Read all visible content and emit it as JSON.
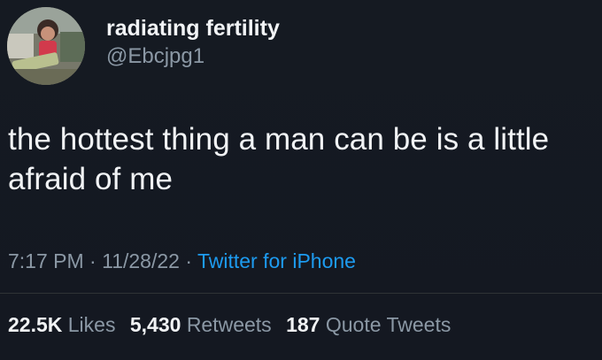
{
  "user": {
    "display_name": "radiating fertility",
    "handle": "@Ebcjpg1"
  },
  "tweet": {
    "text": "the hottest thing a man can be is a little afraid of me",
    "time": "7:17 PM",
    "date": "11/28/22",
    "separator": "·",
    "source": "Twitter for iPhone"
  },
  "stats": {
    "likes_count": "22.5K",
    "likes_label": "Likes",
    "retweets_count": "5,430",
    "retweets_label": "Retweets",
    "quotes_count": "187",
    "quotes_label": "Quote Tweets"
  },
  "colors": {
    "background": "#15202b",
    "accent": "#1d9bf0",
    "secondary_text": "#8b98a5"
  },
  "icons": {
    "avatar": "profile-photo"
  }
}
